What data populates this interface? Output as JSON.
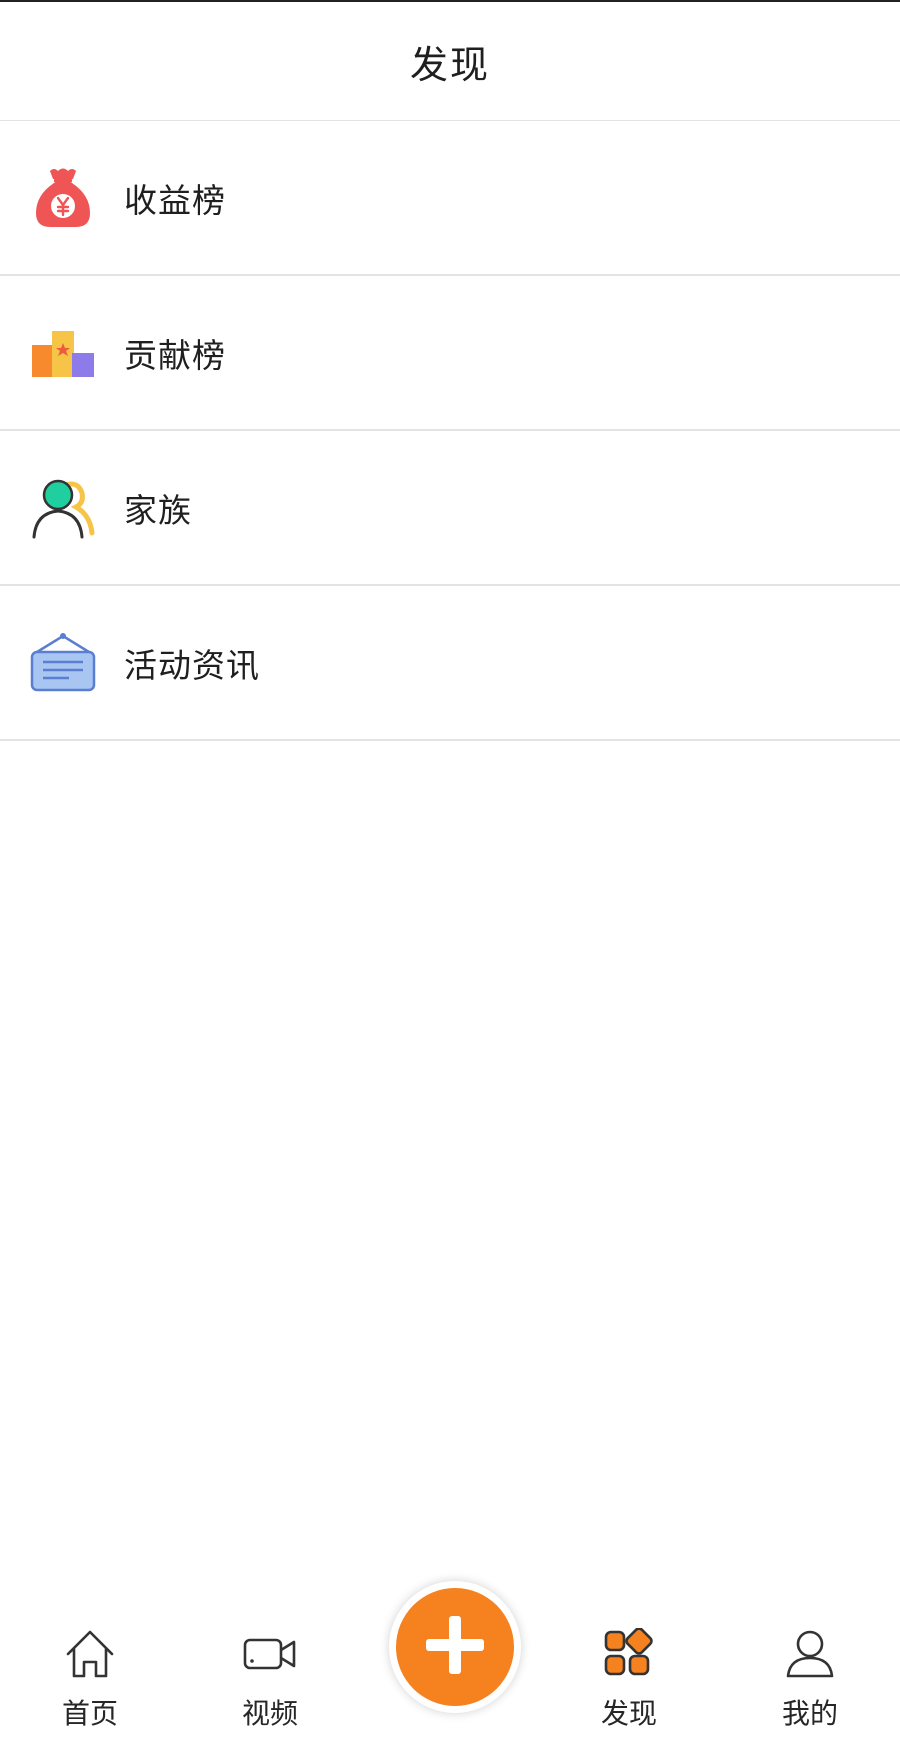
{
  "header": {
    "title": "发现"
  },
  "list": {
    "items": [
      {
        "label": "收益榜",
        "icon": "money-bag-icon"
      },
      {
        "label": "贡献榜",
        "icon": "podium-icon"
      },
      {
        "label": "家族",
        "icon": "family-icon"
      },
      {
        "label": "活动资讯",
        "icon": "notice-board-icon"
      }
    ]
  },
  "tabbar": {
    "items": [
      {
        "label": "首页",
        "icon": "home-icon"
      },
      {
        "label": "视频",
        "icon": "video-camera-icon"
      },
      {
        "label": "",
        "icon": "plus-icon"
      },
      {
        "label": "发现",
        "icon": "discover-grid-icon"
      },
      {
        "label": "我的",
        "icon": "person-icon"
      }
    ],
    "active_index": 3
  },
  "colors": {
    "accent_orange": "#f5821f",
    "money_red": "#f05555",
    "teal": "#1fcf9f",
    "yellow": "#f6c547",
    "purple": "#8c7be8",
    "notice_blue": "#a9c6f2",
    "divider": "#e3e3e3"
  }
}
